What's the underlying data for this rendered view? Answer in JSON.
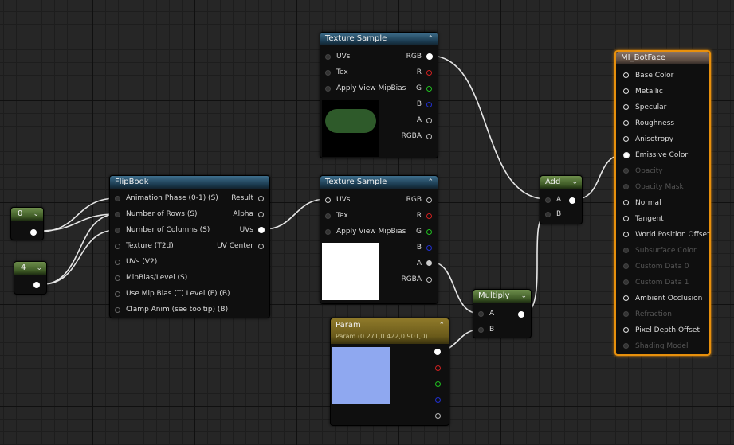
{
  "nodes": {
    "tex1": {
      "title": "Texture Sample",
      "inputs": [
        "UVs",
        "Tex",
        "Apply View MipBias"
      ],
      "outputs": [
        "RGB",
        "R",
        "G",
        "B",
        "A",
        "RGBA"
      ]
    },
    "tex2": {
      "title": "Texture Sample",
      "inputs": [
        "UVs",
        "Tex",
        "Apply View MipBias"
      ],
      "outputs": [
        "RGB",
        "R",
        "G",
        "B",
        "A",
        "RGBA"
      ]
    },
    "flipbook": {
      "title": "FlipBook",
      "inputs": [
        "Animation  Phase (0-1) (S)",
        "Number of Rows (S)",
        "Number of Columns (S)",
        "Texture (T2d)",
        "UVs (V2)",
        "MipBias/Level (S)",
        "Use Mip Bias (T) Level (F) (B)",
        "Clamp Anim (see tooltip) (B)"
      ],
      "outputs": [
        "Result",
        "Alpha",
        "UVs",
        "UV Center"
      ]
    },
    "const0": {
      "title": "0"
    },
    "const4": {
      "title": "4"
    },
    "add": {
      "title": "Add",
      "inputs": [
        "A",
        "B"
      ]
    },
    "multiply": {
      "title": "Multiply",
      "inputs": [
        "A",
        "B"
      ]
    },
    "param": {
      "title": "Param",
      "subtitle": "Param (0.271,0.422,0.901,0)",
      "color": "#8fa8f0"
    },
    "material": {
      "title": "MI_BotFace",
      "inputs": [
        "Base Color",
        "Metallic",
        "Specular",
        "Roughness",
        "Anisotropy",
        "Emissive Color",
        "Opacity",
        "Opacity Mask",
        "Normal",
        "Tangent",
        "World Position Offset",
        "Subsurface Color",
        "Custom Data 0",
        "Custom Data 1",
        "Ambient Occlusion",
        "Refraction",
        "Pixel Depth Offset",
        "Shading Model"
      ],
      "enabled": [
        true,
        true,
        true,
        true,
        true,
        true,
        false,
        false,
        true,
        true,
        true,
        false,
        false,
        false,
        true,
        false,
        true,
        false
      ]
    }
  },
  "colors": {
    "accent": "#e8900c",
    "preview_green": "#2e5a2a",
    "preview_white": "#ffffff"
  }
}
